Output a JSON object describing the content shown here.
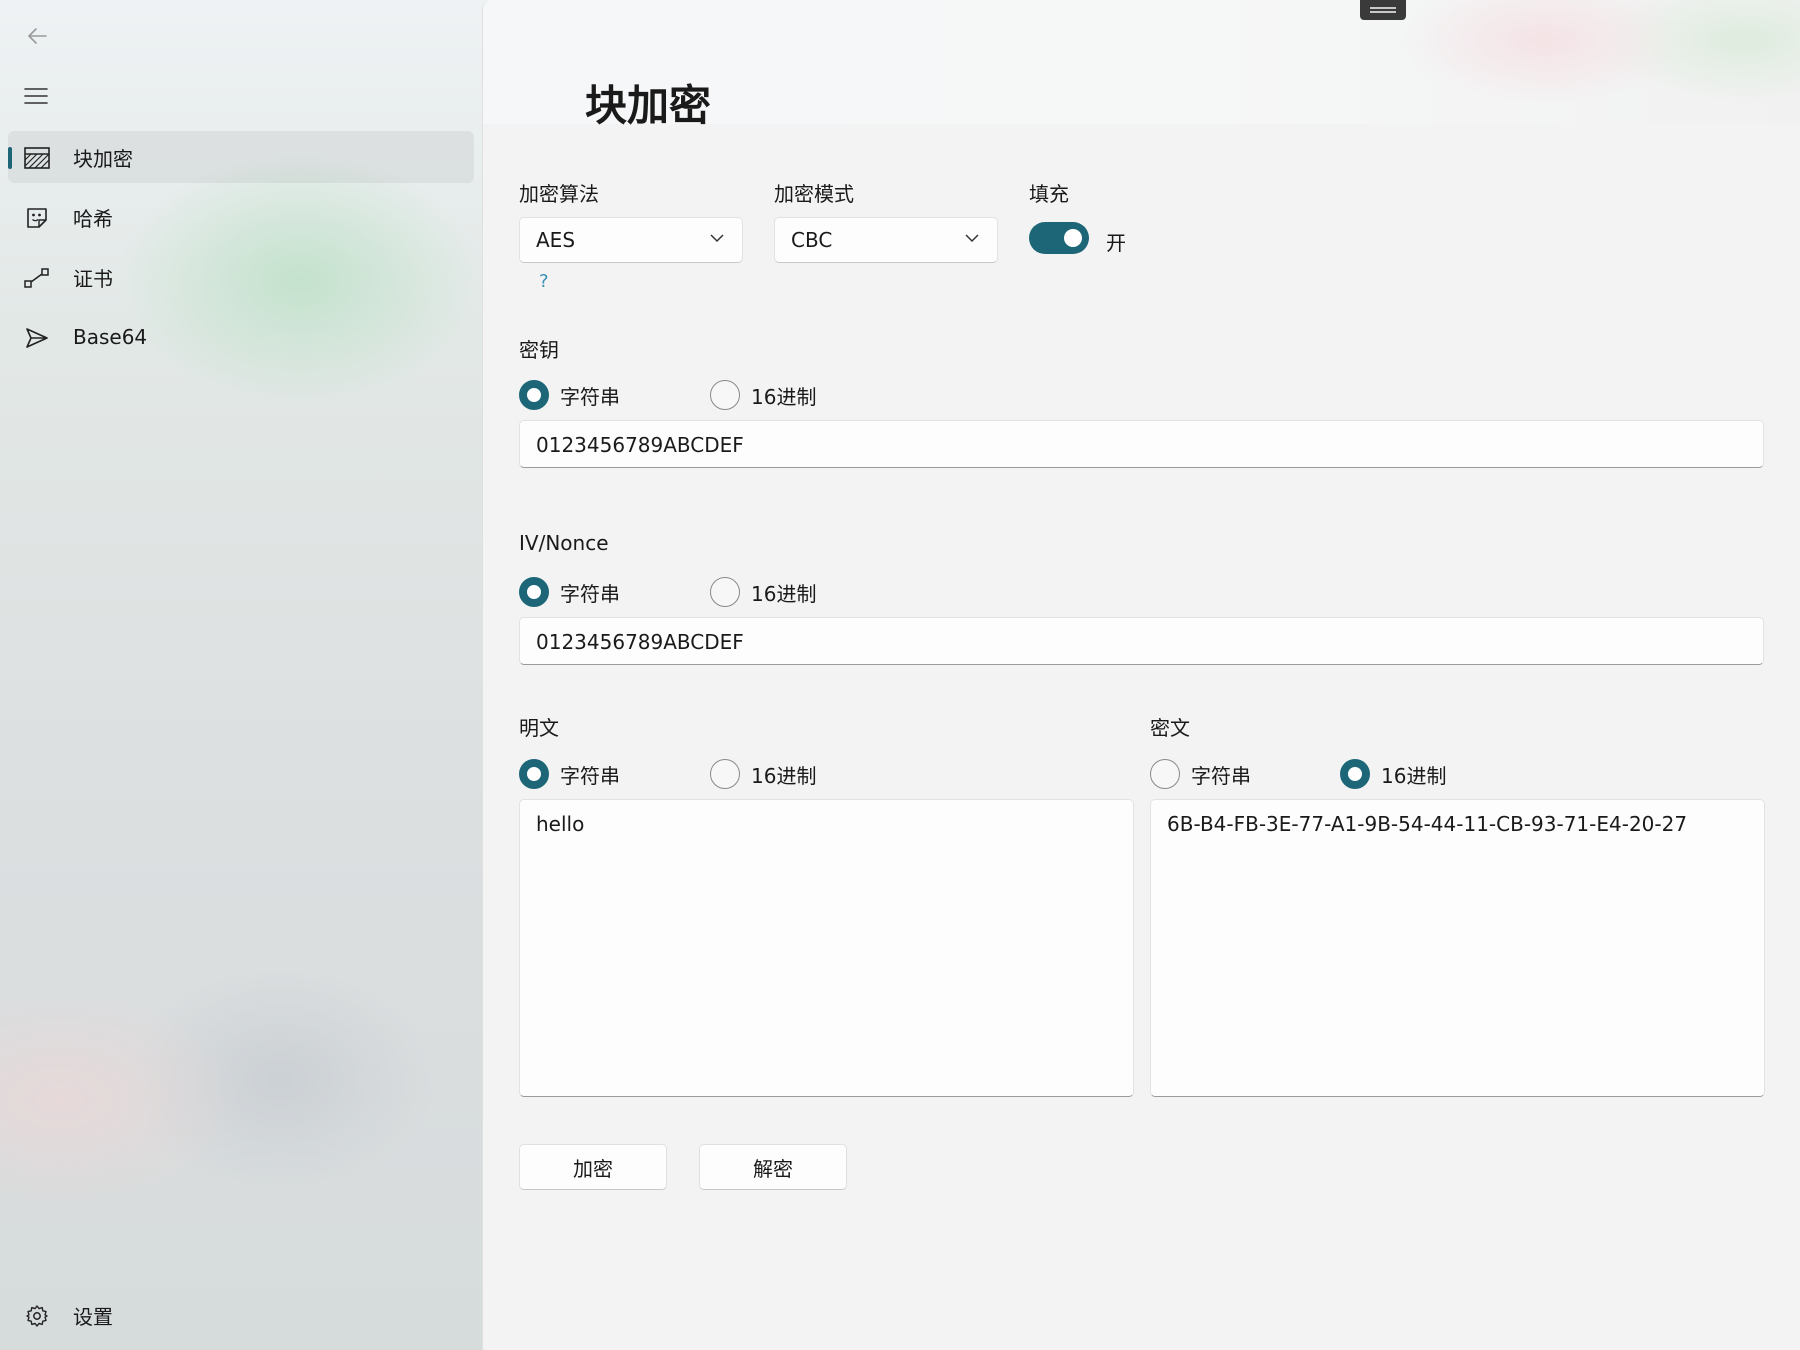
{
  "nav": {
    "back_icon": "back-arrow-icon",
    "menu_icon": "hamburger-menu-icon",
    "items": [
      {
        "label": "块加密",
        "icon": "block-encrypt-icon",
        "selected": true
      },
      {
        "label": "哈希",
        "icon": "hash-icon",
        "selected": false
      },
      {
        "label": "证书",
        "icon": "certificate-icon",
        "selected": false
      },
      {
        "label": "Base64",
        "icon": "send-icon",
        "selected": false
      }
    ],
    "settings": {
      "label": "设置",
      "icon": "gear-icon"
    }
  },
  "page": {
    "title": "块加密"
  },
  "options": {
    "algorithm": {
      "label": "加密算法",
      "value": "AES"
    },
    "mode": {
      "label": "加密模式",
      "value": "CBC"
    },
    "padding": {
      "label": "填充",
      "state_text": "开",
      "on": true
    },
    "help": "?"
  },
  "key": {
    "label": "密钥",
    "format_string": "字符串",
    "format_hex": "16进制",
    "selected": "string",
    "value": "0123456789ABCDEF"
  },
  "iv": {
    "label": "IV/Nonce",
    "format_string": "字符串",
    "format_hex": "16进制",
    "selected": "string",
    "value": "0123456789ABCDEF"
  },
  "plaintext": {
    "label": "明文",
    "format_string": "字符串",
    "format_hex": "16进制",
    "selected": "string",
    "value": "hello"
  },
  "ciphertext": {
    "label": "密文",
    "format_string": "字符串",
    "format_hex": "16进制",
    "selected": "hex",
    "value": "6B-B4-FB-3E-77-A1-9B-54-44-11-CB-93-71-E4-20-27"
  },
  "actions": {
    "encrypt": "加密",
    "decrypt": "解密"
  },
  "colors": {
    "accent": "#1d6678",
    "content_bg": "#f3f3f3",
    "help_link": "#3a8fb5"
  }
}
